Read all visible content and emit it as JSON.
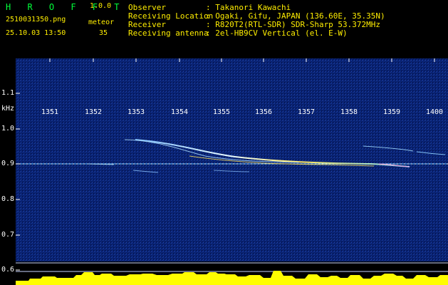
{
  "app": {
    "name": "H R O F F T",
    "version": "1.0.0",
    "filename": "2510031350.png",
    "datetime": "25.10.03 13:50",
    "meteor_label": "meteor",
    "meteor_count": "35"
  },
  "info": {
    "rows": [
      {
        "label": "Observer",
        "value": ": Takanori Kawachi"
      },
      {
        "label": "Receiving Location",
        "value": ": Ogaki, Gifu, JAPAN (136.60E, 35.35N)"
      },
      {
        "label": "Receiver",
        "value": ": R820T2(RTL-SDR) SDR-Sharp 53.372MHz"
      },
      {
        "label": "Receiving antenna",
        "value": ": 2el-HB9CV Vertical (el. E-W)"
      }
    ]
  },
  "axes": {
    "unit": "kHz",
    "x_ticks": [
      "1351",
      "1352",
      "1353",
      "1354",
      "1355",
      "1356",
      "1357",
      "1358",
      "1359",
      "1400"
    ],
    "y_ticks": [
      "1.1",
      "1.0",
      "0.9",
      "0.8",
      "0.7",
      "0.6"
    ]
  },
  "colors": {
    "header_text": "#ffee00",
    "title_text": "#00ff3a",
    "background": "#000000",
    "spectrogram_bg": "#081f6d",
    "trail_main": "#e7f6ff",
    "trail_accent": "#ffea00",
    "bottom_bars": "#ffff00"
  }
}
